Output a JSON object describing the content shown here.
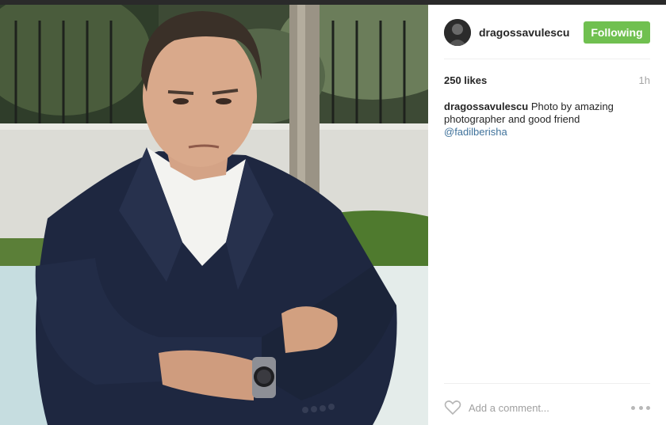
{
  "post": {
    "photo_icon": "post-photo",
    "colors": {
      "follow_button": "#70c050",
      "mention": "#3f729b",
      "muted": "#a5a5a5"
    }
  },
  "header": {
    "username": "dragossavulescu",
    "follow_label": "Following"
  },
  "stats": {
    "likes": "250 likes",
    "time": "1h"
  },
  "caption": {
    "username": "dragossavulescu",
    "text": "Photo by amazing photographer and good friend",
    "mention": "@fadilberisha"
  },
  "comment": {
    "placeholder": "Add a comment...",
    "like_icon": "heart-icon",
    "more_icon": "more-options-icon"
  }
}
